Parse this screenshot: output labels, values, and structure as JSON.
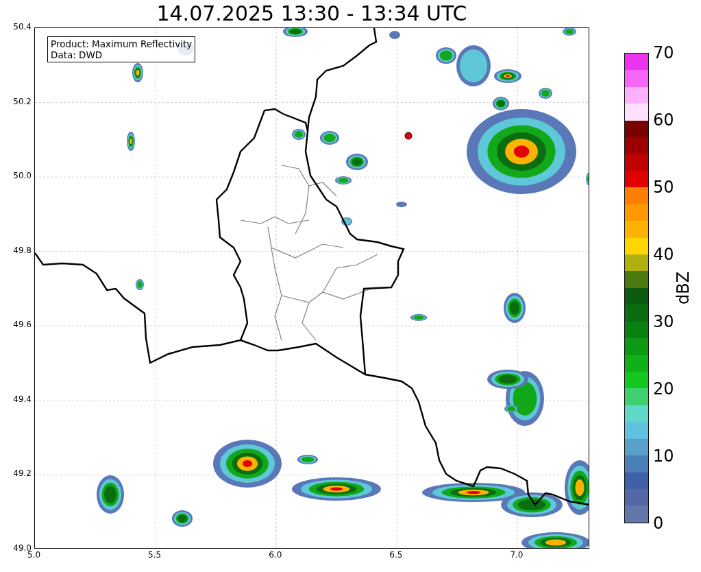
{
  "title": "14.07.2025 13:30 - 13:34 UTC",
  "legend": [
    "Product: Maximum Reflectivity",
    "Data: DWD"
  ],
  "x_ticks": [
    "5.0",
    "5.5",
    "6.0",
    "6.5",
    "7.0"
  ],
  "y_ticks": [
    "50.4",
    "50.2",
    "50.0",
    "49.8",
    "49.6",
    "49.4",
    "49.2",
    "49.0"
  ],
  "colorbar": {
    "label": "dBZ",
    "ticks": [
      "70",
      "60",
      "50",
      "40",
      "30",
      "20",
      "10",
      "0"
    ],
    "segments": [
      {
        "color": "#ee33ee"
      },
      {
        "color": "#f866f8"
      },
      {
        "color": "#ffb0ff"
      },
      {
        "color": "#ffe0ff"
      },
      {
        "color": "#7a0000"
      },
      {
        "color": "#9a0000"
      },
      {
        "color": "#c00000"
      },
      {
        "color": "#e00000"
      },
      {
        "color": "#ff7f00"
      },
      {
        "color": "#ff9900"
      },
      {
        "color": "#ffb300"
      },
      {
        "color": "#ffd700"
      },
      {
        "color": "#b0b010"
      },
      {
        "color": "#4a7a10"
      },
      {
        "color": "#0a5a10"
      },
      {
        "color": "#0a6e10"
      },
      {
        "color": "#0a8010"
      },
      {
        "color": "#0a9a14"
      },
      {
        "color": "#10b01a"
      },
      {
        "color": "#14c820"
      },
      {
        "color": "#3ed070"
      },
      {
        "color": "#60d8c8"
      },
      {
        "color": "#60c0e0"
      },
      {
        "color": "#58a0c8"
      },
      {
        "color": "#4a80b8"
      },
      {
        "color": "#4060a8"
      },
      {
        "color": "#5468a8"
      },
      {
        "color": "#6478a8"
      }
    ]
  }
}
